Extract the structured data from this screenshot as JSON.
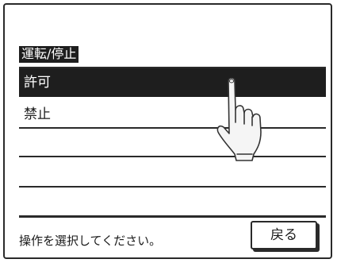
{
  "header": {
    "title": "運転/停止"
  },
  "options": {
    "items": [
      {
        "label": "許可",
        "selected": true
      },
      {
        "label": "禁止",
        "selected": false
      },
      {
        "label": "",
        "selected": false
      },
      {
        "label": "",
        "selected": false
      }
    ]
  },
  "footer": {
    "status_text": "操作を選択してください。",
    "back_label": "戻る"
  },
  "icons": {
    "pointer": "tap-hand-icon"
  },
  "colors": {
    "selected_background": "#1e1e1e",
    "selected_text": "#ffffff",
    "border": "#2a2a2a"
  }
}
